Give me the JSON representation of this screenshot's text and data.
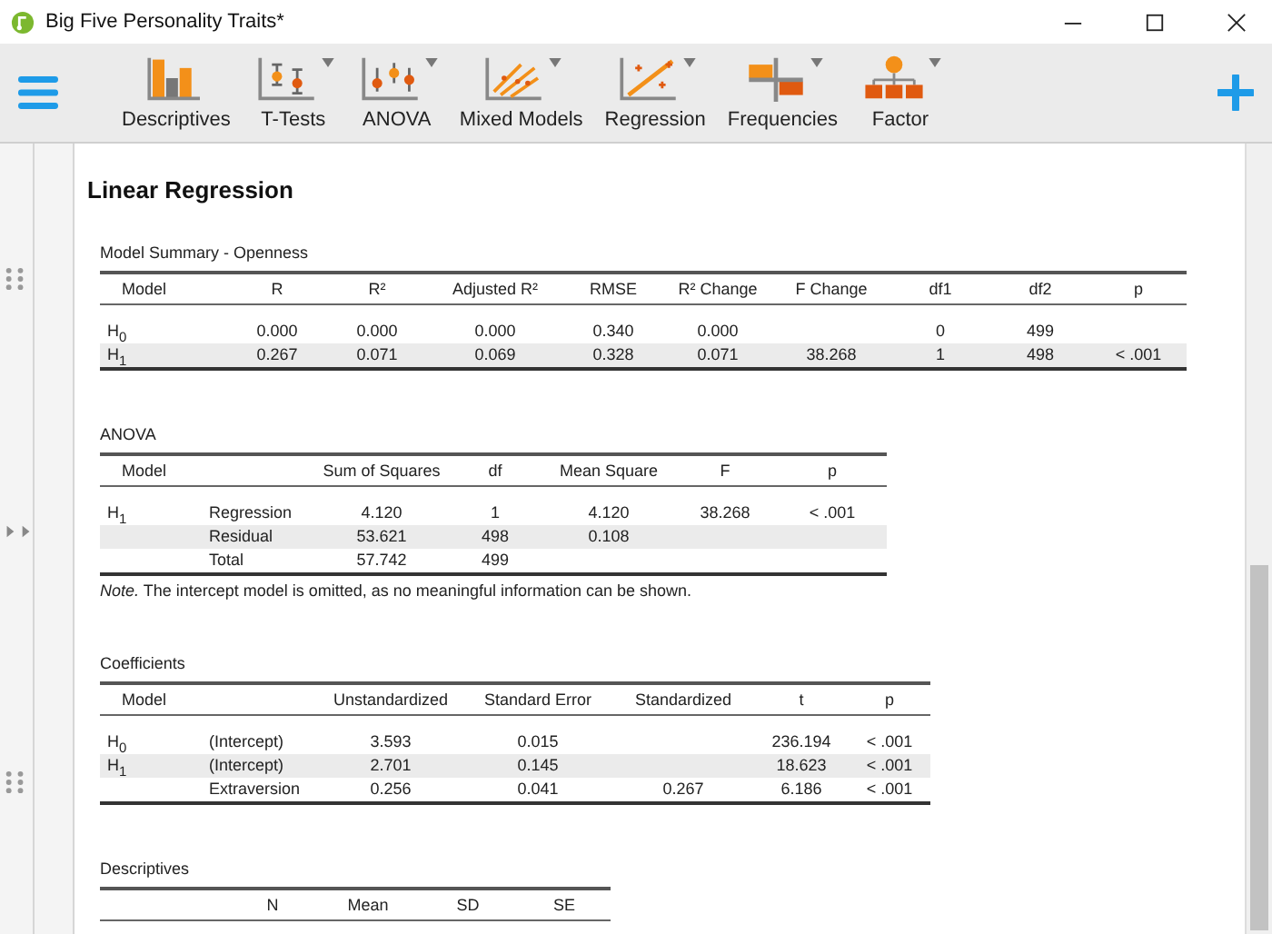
{
  "window": {
    "title": "Big Five Personality Traits*"
  },
  "toolbar": {
    "items": [
      {
        "label": "Descriptives",
        "has_menu": false
      },
      {
        "label": "T-Tests",
        "has_menu": true
      },
      {
        "label": "ANOVA",
        "has_menu": true
      },
      {
        "label": "Mixed Models",
        "has_menu": true
      },
      {
        "label": "Regression",
        "has_menu": true
      },
      {
        "label": "Frequencies",
        "has_menu": true
      },
      {
        "label": "Factor",
        "has_menu": true
      }
    ]
  },
  "results": {
    "heading": "Linear Regression",
    "tables": [
      {
        "title": "Model Summary - Openness",
        "columns": [
          "Model",
          "R",
          "R²",
          "Adjusted R²",
          "RMSE",
          "R² Change",
          "F Change",
          "df1",
          "df2",
          "p"
        ],
        "rows": [
          [
            "H$_{0}$",
            "0.000",
            "0.000",
            "0.000",
            "0.340",
            "0.000",
            null,
            "0",
            "499",
            null
          ],
          [
            "H$_{1}$",
            "0.267",
            "0.071",
            "0.069",
            "0.328",
            "0.071",
            "38.268",
            "1",
            "498",
            "< .001"
          ]
        ]
      },
      {
        "title": "ANOVA",
        "columns": [
          "Model",
          null,
          "Sum of Squares",
          "df",
          "Mean Square",
          "F",
          "p"
        ],
        "rows": [
          [
            "H$_{1}$",
            "Regression",
            "4.120",
            "1",
            "4.120",
            "38.268",
            "< .001"
          ],
          [
            null,
            "Residual",
            "53.621",
            "498",
            "0.108",
            null,
            null
          ],
          [
            null,
            "Total",
            "57.742",
            "499",
            null,
            null,
            null
          ]
        ],
        "note": "*Note.* The intercept model is omitted, as no meaningful information can be shown."
      },
      {
        "title": "Coefficients",
        "columns": [
          "Model",
          null,
          "Unstandardized",
          "Standard Error",
          "Standardized",
          "t",
          "p"
        ],
        "rows": [
          [
            "H$_{0}$",
            "(Intercept)",
            "3.593",
            "0.015",
            null,
            "236.194",
            "< .001"
          ],
          [
            "H$_{1}$",
            "(Intercept)",
            "2.701",
            "0.145",
            null,
            "18.623",
            "< .001"
          ],
          [
            null,
            "Extraversion",
            "0.256",
            "0.041",
            "0.267",
            "6.186",
            "< .001"
          ]
        ]
      },
      {
        "title": "Descriptives",
        "columns": [
          null,
          "N",
          "Mean",
          "SD",
          "SE"
        ]
      }
    ]
  }
}
